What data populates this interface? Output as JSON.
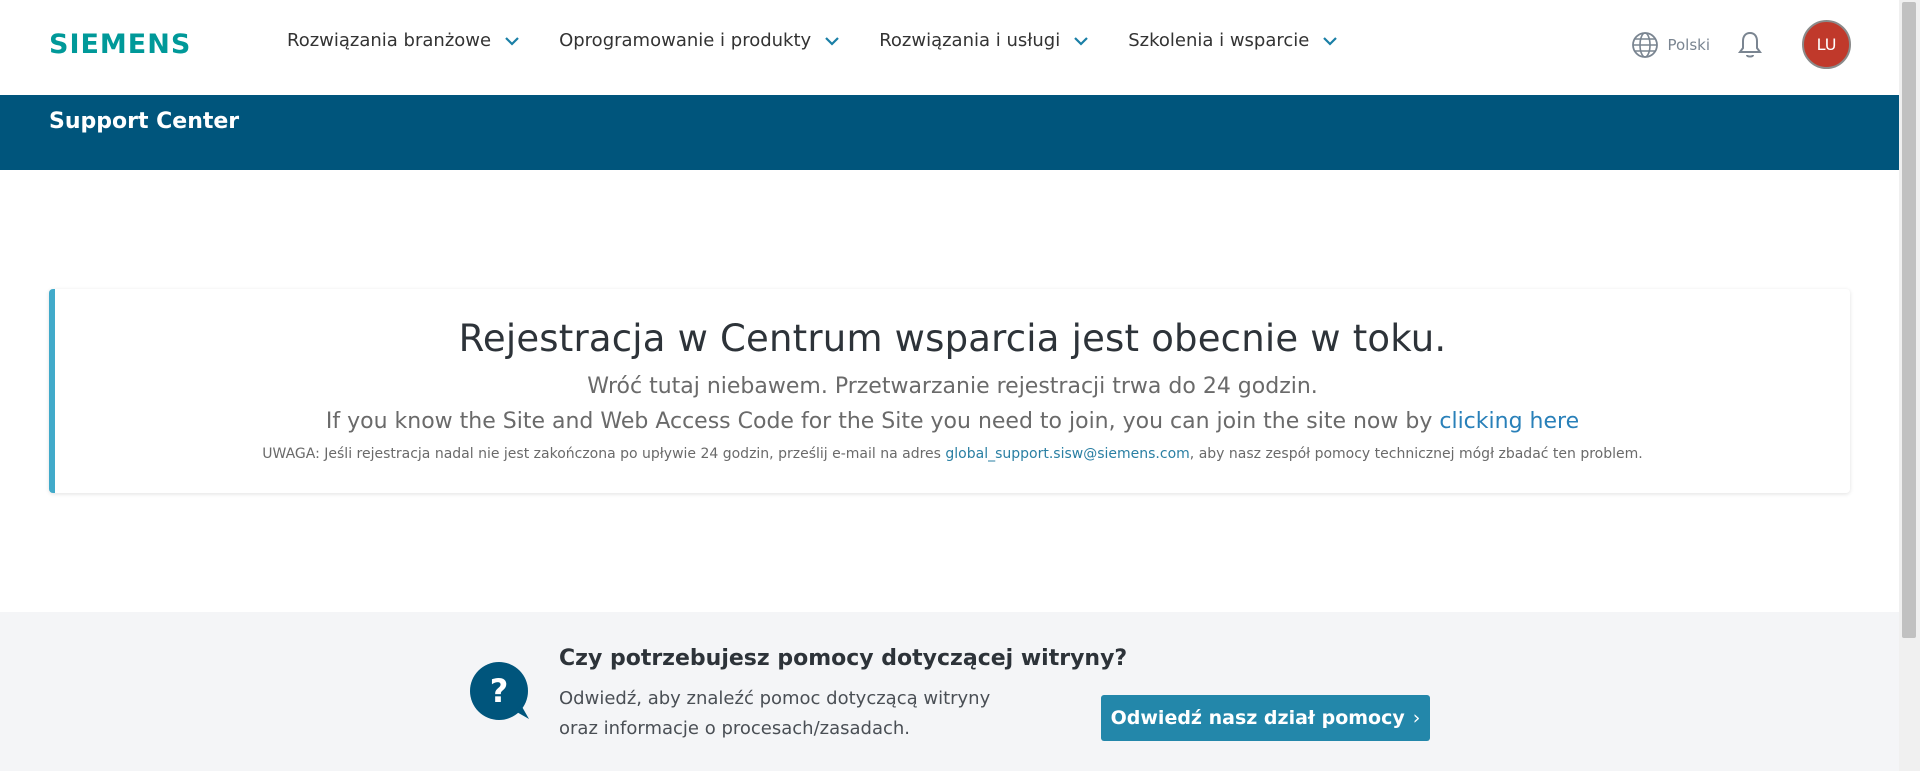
{
  "brand": {
    "logo_text": "SIEMENS",
    "color": "#009999"
  },
  "nav": {
    "items": [
      {
        "label": "Rozwiązania branżowe"
      },
      {
        "label": "Oprogramowanie i produkty"
      },
      {
        "label": "Rozwiązania i usługi"
      },
      {
        "label": "Szkolenia i wsparcie"
      }
    ],
    "language": "Polski",
    "avatar_initials": "LU"
  },
  "banner": {
    "title": "Support Center",
    "color": "#00557c"
  },
  "notice": {
    "heading": "Rejestracja w Centrum wsparcia jest obecnie w toku.",
    "line1": "Wróć tutaj niebawem. Przetwarzanie rejestracji trwa do 24 godzin.",
    "line2_prefix": "If you know the Site and Web Access Code for the Site you need to join, you can join the site now by ",
    "line2_link": "clicking here",
    "note_prefix": "UWAGA: Jeśli rejestracja nadal nie jest zakończona po upływie 24 godzin, prześlij e-mail na adres ",
    "note_email": "global_support.sisw@siemens.com",
    "note_suffix": ", aby nasz zespół pomocy technicznej mógł zbadać ten problem."
  },
  "help": {
    "title": "Czy potrzebujesz pomocy dotyczącej witryny?",
    "description": "Odwiedź, aby znaleźć pomoc dotyczącą witryny oraz informacje o procesach/zasadach.",
    "button_label": "Odwiedź nasz dział pomocy",
    "button_arrow": "›",
    "icon": "question-bubble-icon"
  }
}
